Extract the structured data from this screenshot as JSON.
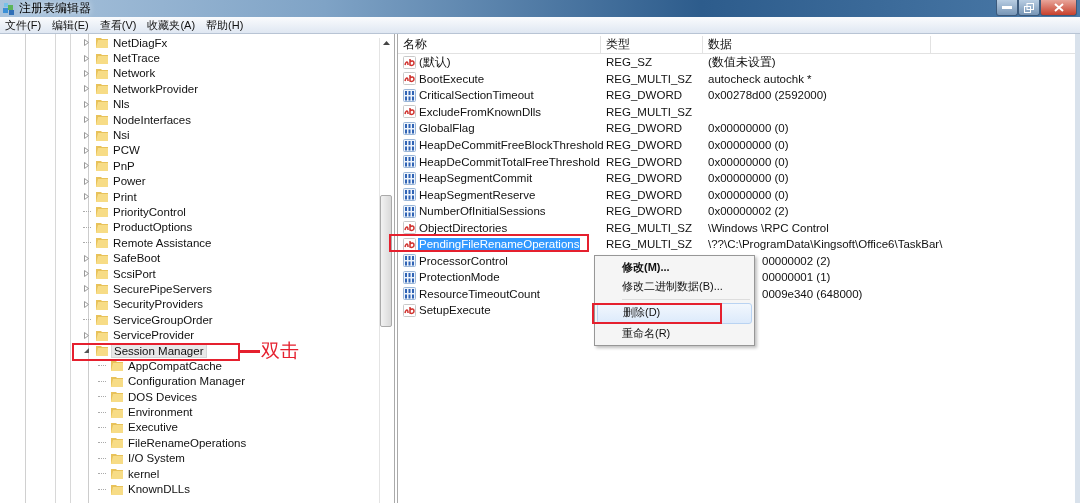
{
  "window": {
    "title": "注册表编辑器"
  },
  "menu_bar": [
    "文件(F)",
    "编辑(E)",
    "查看(V)",
    "收藏夹(A)",
    "帮助(H)"
  ],
  "tree": [
    {
      "name": "NetDiagFx",
      "expanded": false,
      "selected": false
    },
    {
      "name": "NetTrace",
      "expanded": false,
      "selected": false
    },
    {
      "name": "Network",
      "expanded": false,
      "selected": false
    },
    {
      "name": "NetworkProvider",
      "expanded": false,
      "selected": false
    },
    {
      "name": "Nls",
      "expanded": false,
      "selected": false
    },
    {
      "name": "NodeInterfaces",
      "expanded": false,
      "selected": false
    },
    {
      "name": "Nsi",
      "expanded": false,
      "selected": false
    },
    {
      "name": "PCW",
      "expanded": false,
      "selected": false
    },
    {
      "name": "PnP",
      "expanded": false,
      "selected": false
    },
    {
      "name": "Power",
      "expanded": false,
      "selected": false
    },
    {
      "name": "Print",
      "expanded": false,
      "selected": false
    },
    {
      "name": "PriorityControl",
      "selected": false
    },
    {
      "name": "ProductOptions",
      "selected": false
    },
    {
      "name": "Remote Assistance",
      "selected": false
    },
    {
      "name": "SafeBoot",
      "expanded": false,
      "selected": false
    },
    {
      "name": "ScsiPort",
      "expanded": false,
      "selected": false
    },
    {
      "name": "SecurePipeServers",
      "expanded": false,
      "selected": false
    },
    {
      "name": "SecurityProviders",
      "expanded": false,
      "selected": false
    },
    {
      "name": "ServiceGroupOrder",
      "selected": false
    },
    {
      "name": "ServiceProvider",
      "expanded": false,
      "selected": false
    },
    {
      "name": "Session Manager",
      "expanded": true,
      "selected": true,
      "children": [
        {
          "name": "AppCompatCache",
          "selected": false
        },
        {
          "name": "Configuration Manager",
          "selected": false
        },
        {
          "name": "DOS Devices",
          "selected": false
        },
        {
          "name": "Environment",
          "selected": false
        },
        {
          "name": "Executive",
          "selected": false
        },
        {
          "name": "FileRenameOperations",
          "selected": false
        },
        {
          "name": "I/O System",
          "selected": false
        },
        {
          "name": "kernel",
          "selected": false
        },
        {
          "name": "KnownDLLs",
          "selected": false
        }
      ]
    }
  ],
  "double_click_label": "双击",
  "values_table": {
    "columns": [
      "名称",
      "类型",
      "数据"
    ],
    "rows": [
      {
        "kind": "string",
        "name": "(默认)",
        "type": "REG_SZ",
        "data": "(数值未设置)",
        "selected": false
      },
      {
        "kind": "string",
        "name": "BootExecute",
        "type": "REG_MULTI_SZ",
        "data": "autocheck autochk *",
        "selected": false
      },
      {
        "kind": "binary",
        "name": "CriticalSectionTimeout",
        "type": "REG_DWORD",
        "data": "0x00278d00 (2592000)",
        "selected": false
      },
      {
        "kind": "string",
        "name": "ExcludeFromKnownDlls",
        "type": "REG_MULTI_SZ",
        "selected": false
      },
      {
        "kind": "binary",
        "name": "GlobalFlag",
        "type": "REG_DWORD",
        "data": "0x00000000 (0)",
        "selected": false
      },
      {
        "kind": "binary",
        "name": "HeapDeCommitFreeBlockThreshold",
        "type": "REG_DWORD",
        "data": "0x00000000 (0)",
        "selected": false
      },
      {
        "kind": "binary",
        "name": "HeapDeCommitTotalFreeThreshold",
        "type": "REG_DWORD",
        "data": "0x00000000 (0)",
        "selected": false
      },
      {
        "kind": "binary",
        "name": "HeapSegmentCommit",
        "type": "REG_DWORD",
        "data": "0x00000000 (0)",
        "selected": false
      },
      {
        "kind": "binary",
        "name": "HeapSegmentReserve",
        "type": "REG_DWORD",
        "data": "0x00000000 (0)",
        "selected": false
      },
      {
        "kind": "binary",
        "name": "NumberOfInitialSessions",
        "type": "REG_DWORD",
        "data": "0x00000002 (2)",
        "selected": false
      },
      {
        "kind": "string",
        "name": "ObjectDirectories",
        "type": "REG_MULTI_SZ",
        "data": "\\Windows \\RPC Control",
        "selected": false
      },
      {
        "kind": "string",
        "name": "PendingFileRenameOperations",
        "type": "REG_MULTI_SZ",
        "data": "\\??\\C:\\ProgramData\\Kingsoft\\Office6\\TaskBar\\",
        "selected": true
      },
      {
        "kind": "binary",
        "name": "ProcessorControl",
        "data": "00000002 (2)",
        "selected": false
      },
      {
        "kind": "binary",
        "name": "ProtectionMode",
        "data": "00000001 (1)",
        "selected": false
      },
      {
        "kind": "binary",
        "name": "ResourceTimeoutCount",
        "data": "0009e340 (648000)",
        "selected": false
      },
      {
        "kind": "string",
        "name": "SetupExecute",
        "selected": false
      }
    ]
  },
  "context_menu": [
    {
      "label": "修改(M)...",
      "bold": true,
      "selected": false
    },
    {
      "label": "修改二进制数据(B)...",
      "bold": false,
      "selected": false,
      "separator_after": true
    },
    {
      "label": "删除(D)",
      "bold": false,
      "selected": true
    },
    {
      "label": "重命名(R)",
      "bold": false,
      "selected": false
    }
  ]
}
